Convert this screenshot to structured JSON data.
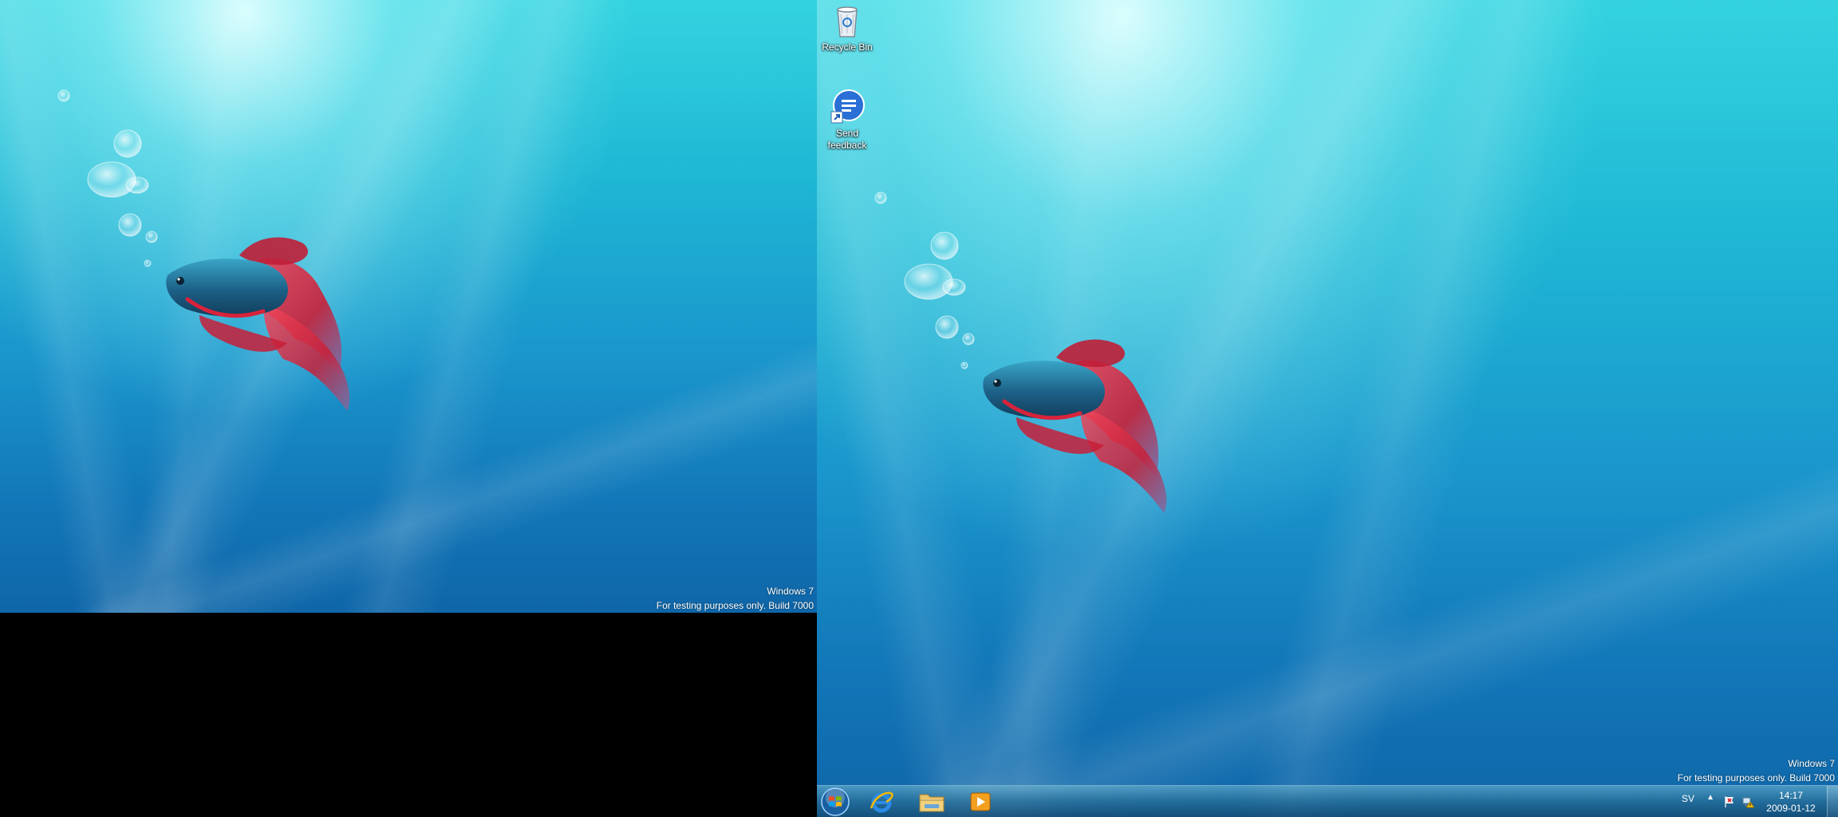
{
  "watermark": {
    "line1": "Windows 7",
    "line2": "For testing purposes only. Build 7000"
  },
  "desktop_icons": [
    {
      "label": "Recycle Bin",
      "icon": "recycle-bin-icon"
    },
    {
      "label": "Send feedback",
      "icon": "send-feedback-icon"
    }
  ],
  "taskbar": {
    "start_icon": "windows-start-orb-icon",
    "pinned": [
      {
        "name": "internet-explorer",
        "icon": "internet-explorer-icon"
      },
      {
        "name": "windows-explorer",
        "icon": "folder-icon"
      },
      {
        "name": "windows-media-player",
        "icon": "media-player-icon"
      }
    ],
    "language": "SV",
    "clock": {
      "time": "14:17",
      "date": "2009-01-12"
    }
  },
  "colors": {
    "wallpaper_top": "#34d3e0",
    "wallpaper_bottom": "#0f66a8",
    "fish_body": "#1c5f86",
    "fish_fins": "#d8233a"
  }
}
